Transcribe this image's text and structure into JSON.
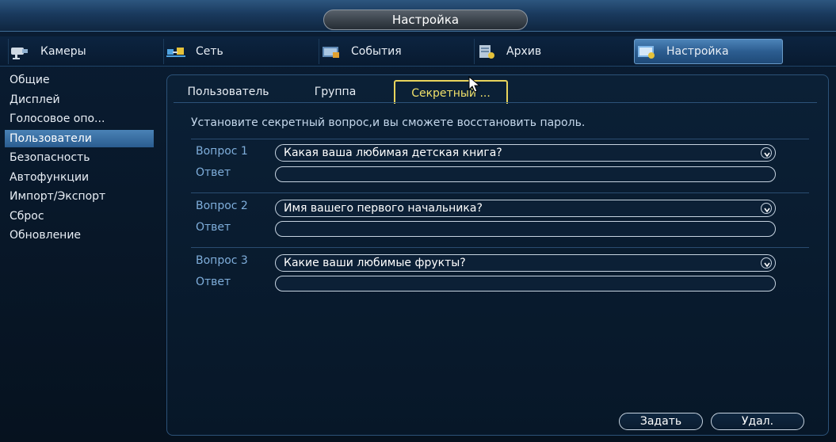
{
  "window": {
    "title": "Настройка"
  },
  "topnav": {
    "items": [
      {
        "label": "Камеры",
        "icon": "camera-icon"
      },
      {
        "label": "Сеть",
        "icon": "network-icon"
      },
      {
        "label": "События",
        "icon": "events-icon"
      },
      {
        "label": "Архив",
        "icon": "archive-icon"
      },
      {
        "label": "Настройка",
        "icon": "settings-icon",
        "active": true
      }
    ]
  },
  "sidebar": {
    "items": [
      {
        "label": "Общие"
      },
      {
        "label": "Дисплей"
      },
      {
        "label": "Голосовое опо..."
      },
      {
        "label": "Пользователи",
        "active": true
      },
      {
        "label": "Безопасность"
      },
      {
        "label": "Автофункции"
      },
      {
        "label": "Импорт/Экспорт"
      },
      {
        "label": "Сброс"
      },
      {
        "label": "Обновление"
      }
    ]
  },
  "main": {
    "tabs": [
      {
        "label": "Пользователь"
      },
      {
        "label": "Группа"
      },
      {
        "label": "Секретный ...",
        "active": true
      }
    ],
    "hint": "Установите секретный вопрос,и вы сможете восстановить пароль.",
    "questions": [
      {
        "label": "Вопрос 1",
        "value": "Какая ваша любимая детская книга?",
        "answer_label": "Ответ",
        "answer_value": ""
      },
      {
        "label": "Вопрос 2",
        "value": "Имя вашего первого начальника?",
        "answer_label": "Ответ",
        "answer_value": ""
      },
      {
        "label": "Вопрос 3",
        "value": "Какие ваши любимые фрукты?",
        "answer_label": "Ответ",
        "answer_value": ""
      }
    ],
    "buttons": {
      "set_label": "Задать",
      "delete_label": "Удал."
    }
  },
  "colors": {
    "accent": "#2c5d90",
    "active_tab_border": "#e8d45c",
    "label_blue": "#7faedb"
  }
}
